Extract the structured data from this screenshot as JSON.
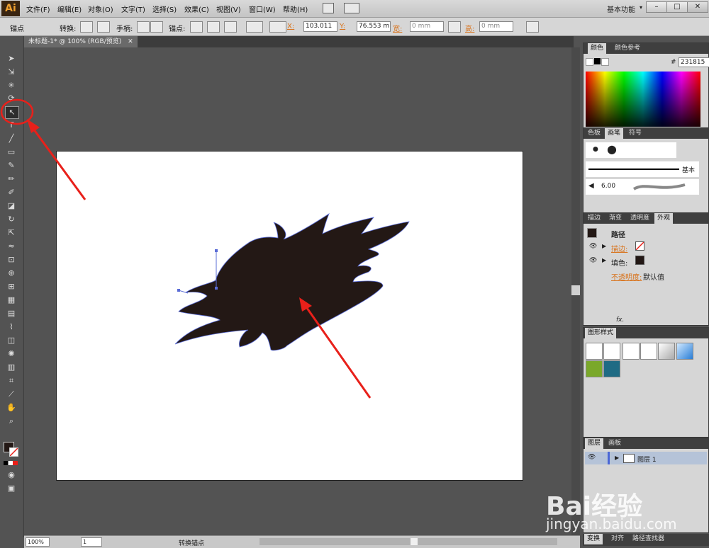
{
  "app": {
    "logo": "Ai"
  },
  "menu": [
    "文件(F)",
    "编辑(E)",
    "对象(O)",
    "文字(T)",
    "选择(S)",
    "效果(C)",
    "视图(V)",
    "窗口(W)",
    "帮助(H)"
  ],
  "workspace": "基本功能",
  "window_buttons": [
    "–",
    "□",
    "✕"
  ],
  "control_bar": {
    "section": "锚点",
    "convert_label": "转换:",
    "handle_label": "手柄:",
    "anchor_label": "锚点:",
    "x_label": "X:",
    "x_value": "103.011",
    "y_label": "Y:",
    "y_value": "76.553 m",
    "w_label": "宽:",
    "w_value": "0 mm",
    "h_label": "高:",
    "h_value": "0 mm"
  },
  "document_tab": {
    "title": "未标题-1* @ 100% (RGB/预览)",
    "close": "✕"
  },
  "status_bar": {
    "zoom": "100%",
    "artboard": "1",
    "tool_status": "转换锚点"
  },
  "panels": {
    "color": {
      "tabs": [
        "颜色",
        "颜色参考"
      ],
      "hex_label": "#",
      "hex_value": "231815"
    },
    "brush": {
      "tabs": [
        "色板",
        "画笔",
        "符号"
      ],
      "basic_label": "基本",
      "size_value": "6.00"
    },
    "appearance": {
      "tabs": [
        "描边",
        "渐变",
        "透明度",
        "外观"
      ],
      "path_label": "路径",
      "stroke_label": "描边:",
      "fill_label": "填色:",
      "opacity_label": "不透明度:",
      "opacity_value": "默认值",
      "fx": "fx."
    },
    "graphic_styles": {
      "tabs": [
        "图形样式"
      ]
    },
    "layers": {
      "tabs": [
        "图层",
        "画板"
      ],
      "layer_name": "图层 1"
    },
    "bottom": {
      "tabs": [
        "变换",
        "对齐",
        "路径查找器"
      ]
    }
  },
  "colors": {
    "fill": "#231815",
    "annotation": "#e8201a",
    "path_handles": "#5a6cd6"
  },
  "watermark": {
    "text": "Bai经验",
    "url": "jingyan.baidu.com"
  }
}
